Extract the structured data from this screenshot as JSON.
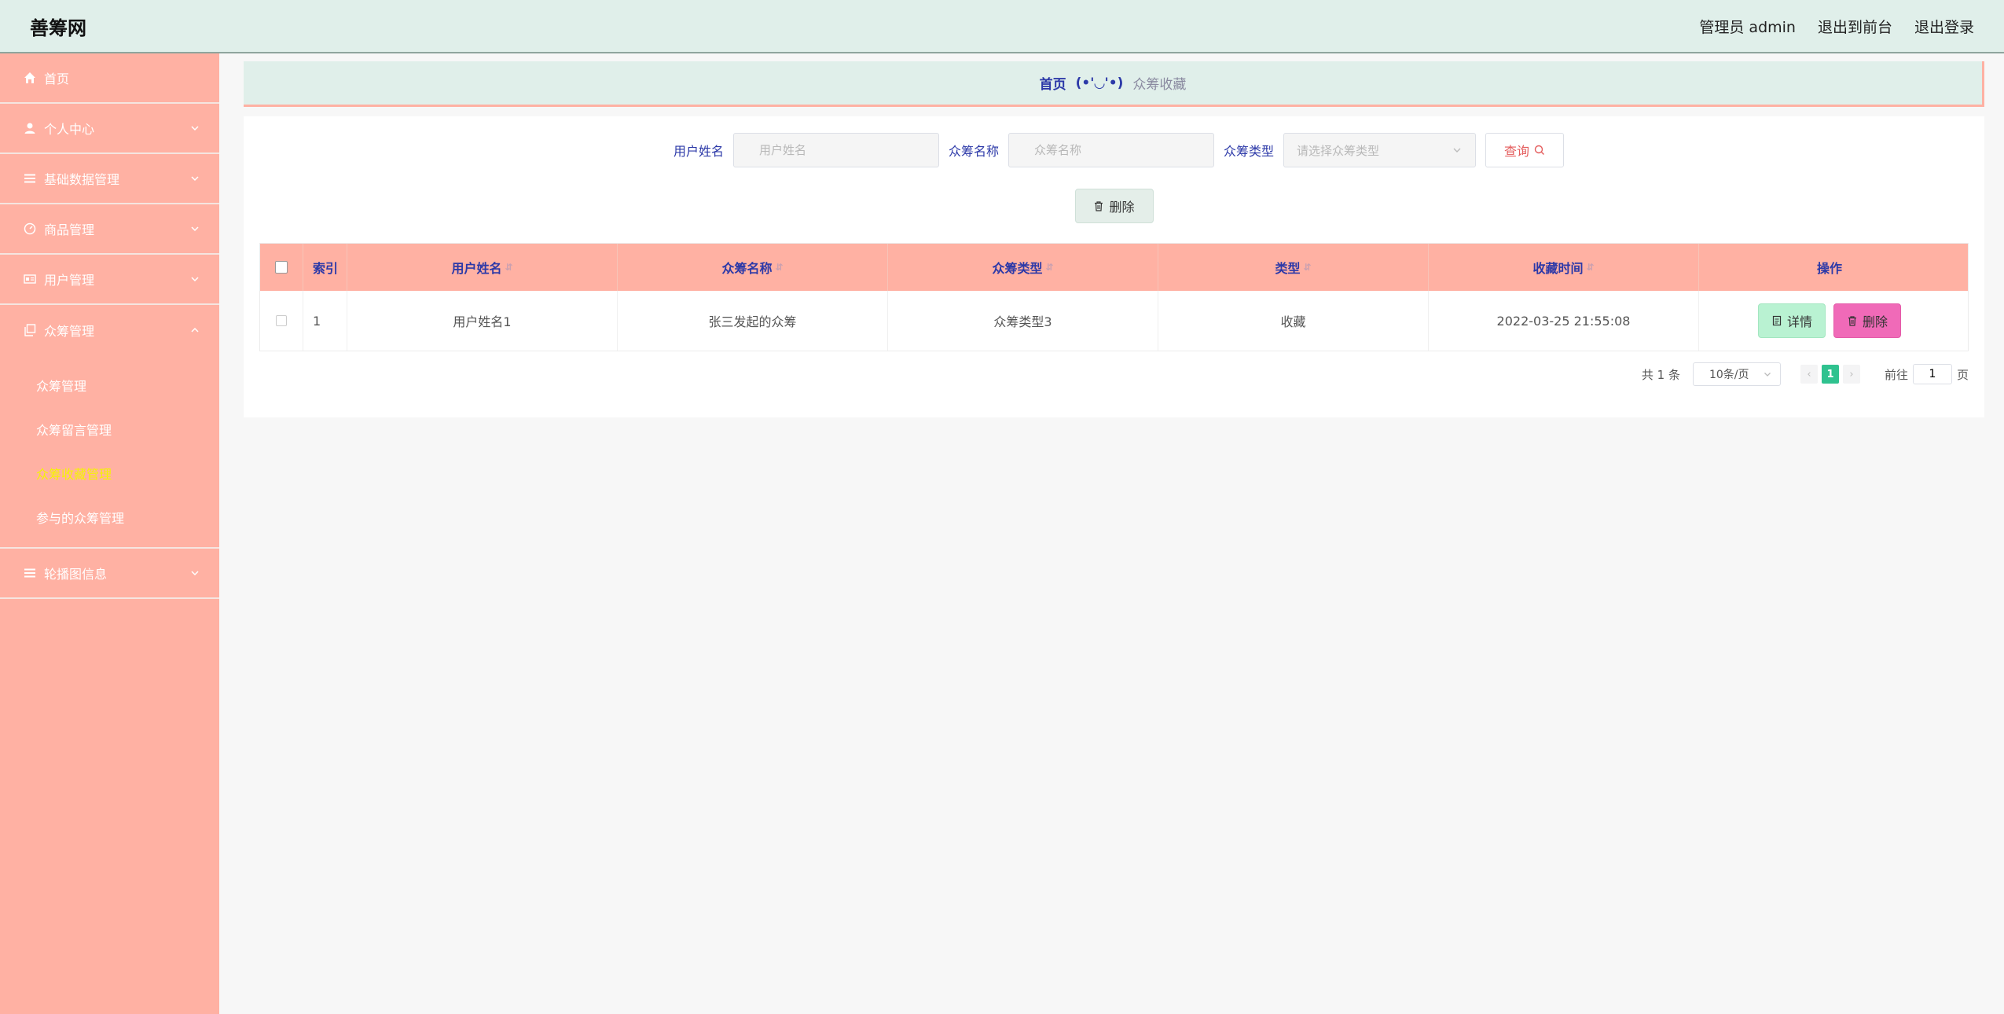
{
  "header": {
    "brand": "善筹网",
    "admin_label": "管理员 admin",
    "back_front": "退出到前台",
    "logout": "退出登录"
  },
  "sidebar": {
    "items": [
      {
        "label": "首页",
        "icon": "home-icon"
      },
      {
        "label": "个人中心",
        "icon": "user-icon"
      },
      {
        "label": "基础数据管理",
        "icon": "list-icon"
      },
      {
        "label": "商品管理",
        "icon": "dashboard-icon"
      },
      {
        "label": "用户管理",
        "icon": "id-card-icon"
      },
      {
        "label": "众筹管理",
        "icon": "copy-icon"
      },
      {
        "label": "轮播图信息",
        "icon": "list-icon"
      }
    ],
    "sub_items": [
      {
        "label": "众筹管理"
      },
      {
        "label": "众筹留言管理"
      },
      {
        "label": "众筹收藏管理"
      },
      {
        "label": "参与的众筹管理"
      }
    ]
  },
  "breadcrumb": {
    "home": "首页",
    "face": "(•'◡'•)",
    "current": "众筹收藏"
  },
  "search": {
    "username_label": "用户姓名",
    "username_placeholder": "用户姓名",
    "name_label": "众筹名称",
    "name_placeholder": "众筹名称",
    "type_label": "众筹类型",
    "type_placeholder": "请选择众筹类型",
    "query_button": "查询"
  },
  "actions": {
    "delete_button": "删除"
  },
  "table": {
    "columns": [
      "索引",
      "用户姓名",
      "众筹名称",
      "众筹类型",
      "类型",
      "收藏时间",
      "操作"
    ],
    "rows": [
      {
        "index": "1",
        "username": "用户姓名1",
        "name": "张三发起的众筹",
        "crowd_type": "众筹类型3",
        "type": "收藏",
        "time": "2022-03-25 21:55:08"
      }
    ],
    "detail_button": "详情",
    "row_delete_button": "删除"
  },
  "pagination": {
    "total": "共 1 条",
    "page_size": "10条/页",
    "current_page": "1",
    "goto_label": "前往",
    "goto_value": "1",
    "page_suffix": "页"
  },
  "colors": {
    "header_bg": "#e0efea",
    "sidebar_bg": "#ffb1a3",
    "accent_blue": "#2c39a8",
    "active_sub": "#f5f500",
    "pager_active": "#2fc28f",
    "delete_pink": "#f06ab8",
    "detail_green": "#b9f2d2"
  }
}
